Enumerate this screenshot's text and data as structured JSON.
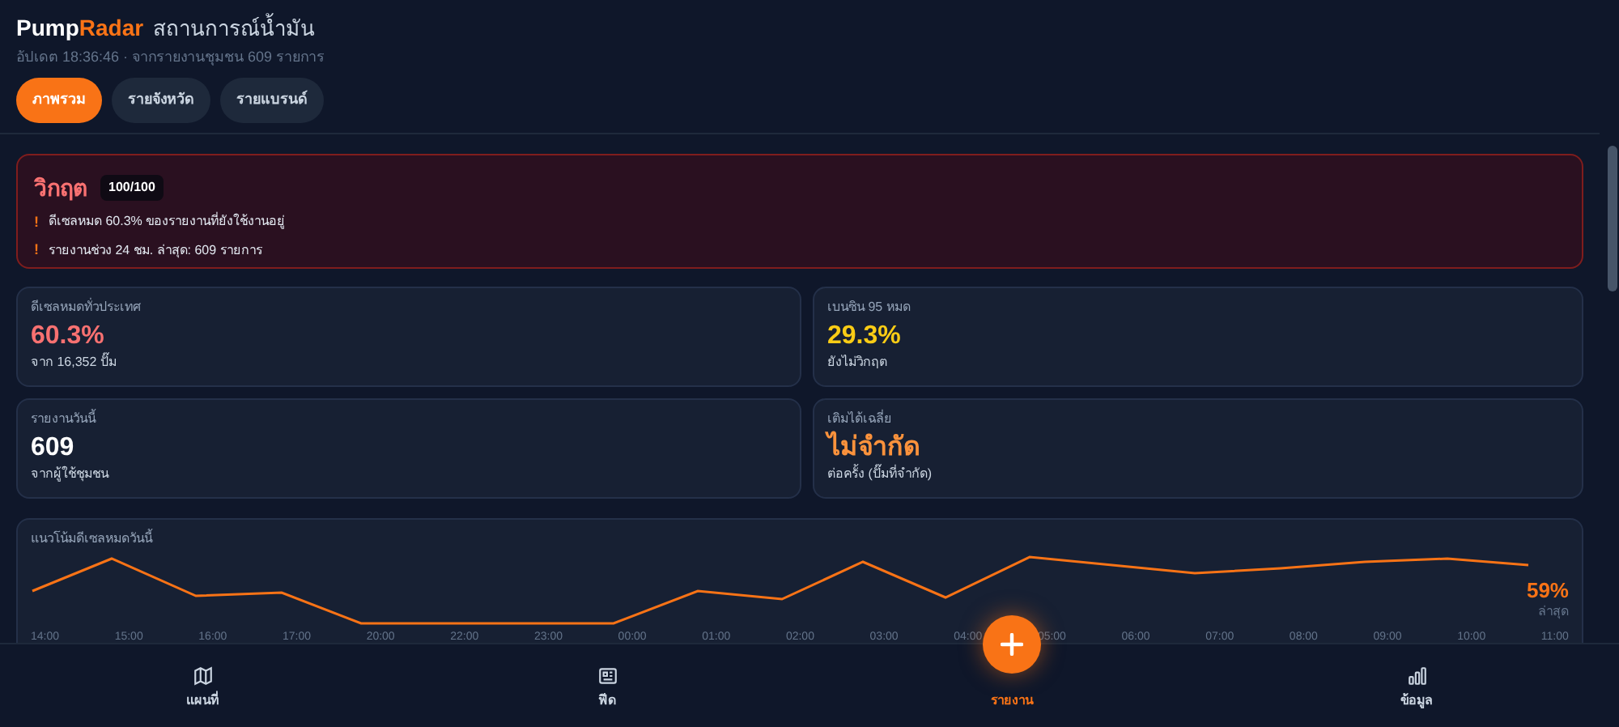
{
  "header": {
    "brand_first": "Pump",
    "brand_second": "Radar",
    "title": "สถานการณ์น้ำมัน",
    "subtitle": "อัปเดต 18:36:46 · จากรายงานชุมชน 609 รายการ"
  },
  "tabs": [
    {
      "label": "ภาพรวม",
      "selected": true
    },
    {
      "label": "รายจังหวัด",
      "selected": false
    },
    {
      "label": "รายแบรนด์",
      "selected": false
    }
  ],
  "alert": {
    "title": "วิกฤต",
    "score": "100/100",
    "items": [
      {
        "icon": "!",
        "text": "ดีเซลหมด 60.3% ของรายงานที่ยังใช้งานอยู่"
      },
      {
        "icon": "!",
        "text": "รายงานช่วง 24 ชม. ล่าสุด: 609 รายการ"
      }
    ]
  },
  "stats": [
    {
      "label": "ดีเซลหมดทั่วประเทศ",
      "value": "60.3%",
      "note": "จาก 16,352 ปั๊ม",
      "color": "#f87171"
    },
    {
      "label": "เบนซิน 95 หมด",
      "value": "29.3%",
      "note": "ยังไม่วิกฤต",
      "color": "#facc15"
    },
    {
      "label": "รายงานวันนี้",
      "value": "609",
      "note": "จากผู้ใช้ชุมชน",
      "color": "#ffffff"
    },
    {
      "label": "เติมได้เฉลี่ย",
      "value": "ไม่จำกัด",
      "note": "ต่อครั้ง (ปั๊มที่จำกัด)",
      "color": "#fb923c"
    }
  ],
  "trend": {
    "title": "แนวโน้มดีเซลหมดวันนี้",
    "latest_value": "59%",
    "latest_label": "ล่าสุด",
    "x_labels": [
      "14:00",
      "15:00",
      "16:00",
      "17:00",
      "20:00",
      "22:00",
      "23:00",
      "00:00",
      "01:00",
      "02:00",
      "03:00",
      "04:00",
      "05:00",
      "06:00",
      "07:00",
      "08:00",
      "09:00",
      "10:00",
      "11:00"
    ]
  },
  "bottom_nav": [
    {
      "kind": "map",
      "label": "แผนที่",
      "selected": false
    },
    {
      "kind": "feed",
      "label": "ฟีด",
      "selected": false
    },
    {
      "kind": "report",
      "label": "รายงาน",
      "selected": true
    },
    {
      "kind": "data",
      "label": "ข้อมูล",
      "selected": false
    }
  ]
}
